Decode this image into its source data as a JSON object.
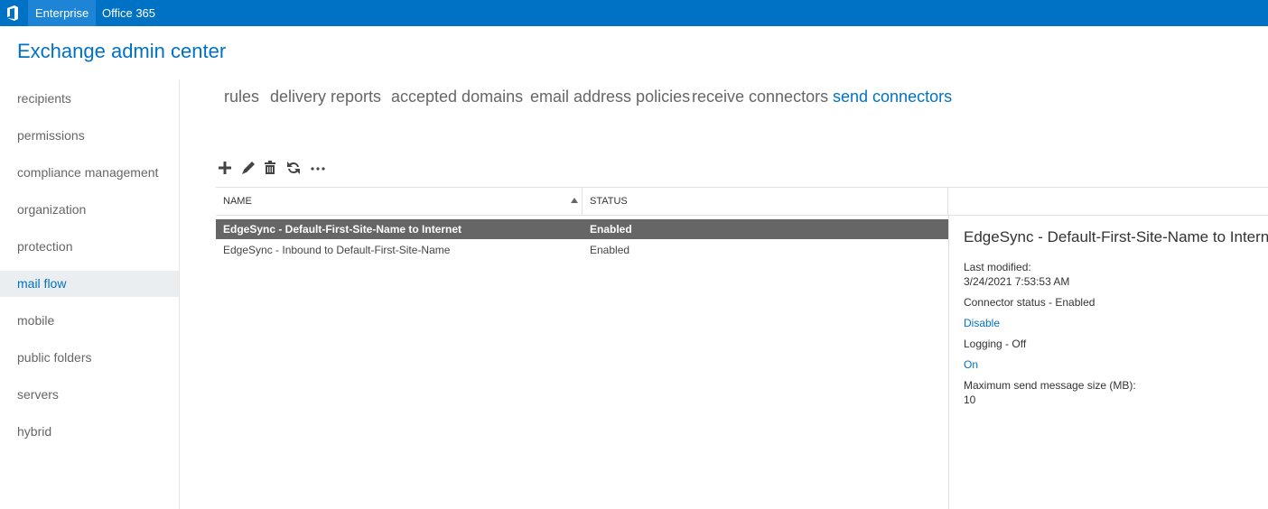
{
  "topbar": {
    "enterprise": "Enterprise",
    "office365": "Office 365"
  },
  "app": {
    "title": "Exchange admin center"
  },
  "nav": {
    "items": [
      {
        "label": "recipients"
      },
      {
        "label": "permissions"
      },
      {
        "label": "compliance management"
      },
      {
        "label": "organization"
      },
      {
        "label": "protection"
      },
      {
        "label": "mail flow",
        "active": true
      },
      {
        "label": "mobile"
      },
      {
        "label": "public folders"
      },
      {
        "label": "servers"
      },
      {
        "label": "hybrid"
      }
    ]
  },
  "tabs": [
    {
      "label": "rules"
    },
    {
      "label": "delivery reports"
    },
    {
      "label": "accepted domains"
    },
    {
      "label": "email address policies"
    },
    {
      "label": "receive connectors"
    },
    {
      "label": "send connectors",
      "active": true
    }
  ],
  "toolbar": {
    "icons": [
      "add-icon",
      "edit-icon",
      "delete-icon",
      "refresh-icon",
      "more-icon"
    ]
  },
  "grid": {
    "columns": {
      "name": "NAME",
      "status": "STATUS"
    },
    "rows": [
      {
        "name": "EdgeSync - Default-First-Site-Name to Internet",
        "status": "Enabled",
        "selected": true
      },
      {
        "name": "EdgeSync - Inbound to Default-First-Site-Name",
        "status": "Enabled"
      }
    ]
  },
  "details": {
    "title": "EdgeSync - Default-First-Site-Name to Internet",
    "last_modified_label": "Last modified:",
    "last_modified_value": "3/24/2021 7:53:53 AM",
    "connector_status": "Connector status - Enabled",
    "disable_link": "Disable",
    "logging": "Logging - Off",
    "on_link": "On",
    "max_size_label": "Maximum send message size (MB):",
    "max_size_value": "10"
  },
  "colors": {
    "accent": "#0072c6",
    "selected_row": "#666666",
    "nav_active_bg": "#ebeef0"
  }
}
